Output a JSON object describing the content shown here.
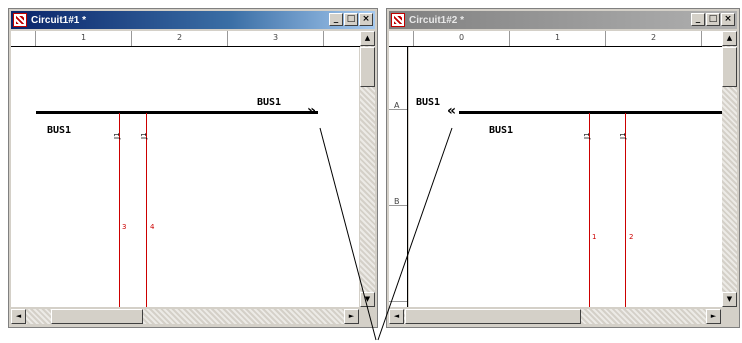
{
  "window1": {
    "title": "Circuit1#1 *",
    "ruler": [
      "1",
      "2",
      "3"
    ],
    "bus_left_label": "BUS1",
    "bus_right_label": "BUS1",
    "offpage_glyph": "»",
    "pins": [
      {
        "number": "3",
        "connector": "J1"
      },
      {
        "number": "4",
        "connector": "J1"
      }
    ]
  },
  "window2": {
    "title": "Circuit1#2 *",
    "ruler": [
      "0",
      "1",
      "2"
    ],
    "vruler": [
      "A",
      "B"
    ],
    "bus_left_label": "BUS1",
    "bus_right_label": "BUS1",
    "offpage_glyph": "«",
    "pins": [
      {
        "number": "1",
        "connector": "J1"
      },
      {
        "number": "2",
        "connector": "J1"
      }
    ]
  },
  "controls": {
    "minimize": "_",
    "maximize": "□",
    "close": "×"
  },
  "scroll": {
    "up": "▲",
    "down": "▼",
    "left": "◄",
    "right": "►"
  },
  "colors": {
    "pin": "#cc0000",
    "bus": "#000000",
    "active_title": "#0a246a",
    "inactive_title": "#808080"
  }
}
